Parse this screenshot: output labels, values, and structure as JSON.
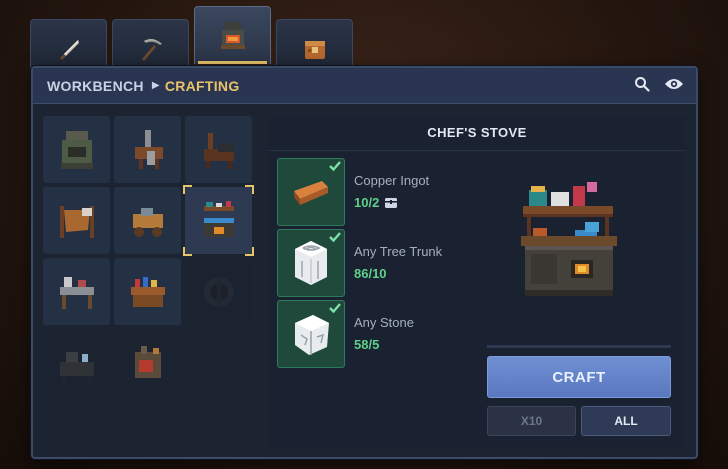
{
  "tabs": [
    {
      "icon": "knife-icon",
      "active": false
    },
    {
      "icon": "pickaxe-icon",
      "active": false
    },
    {
      "icon": "workbench-icon",
      "active": true
    },
    {
      "icon": "crate-icon",
      "active": false
    }
  ],
  "header": {
    "crumb_root": "WORKBENCH",
    "crumb_active": "CRAFTING",
    "search_icon": "search-icon",
    "eye_icon": "eye-icon"
  },
  "recipes": [
    {
      "icon": "furnace-icon"
    },
    {
      "icon": "tool-station-icon"
    },
    {
      "icon": "anvil-icon"
    },
    {
      "icon": "leather-rack-icon"
    },
    {
      "icon": "wood-cart-icon"
    },
    {
      "icon": "chefs-stove-icon",
      "selected": true
    },
    {
      "icon": "sewing-table-icon"
    },
    {
      "icon": "alchemy-table-icon"
    },
    {
      "icon": "locked-wheel-icon",
      "dim": true
    },
    {
      "icon": "grill-station-icon"
    },
    {
      "icon": "smelter-icon"
    }
  ],
  "detail": {
    "title": "CHEF'S STOVE",
    "ingredients": [
      {
        "name": "Copper Ingot",
        "count": "10/2",
        "icon": "copper-ingot-icon",
        "extra_icon": "chest-icon"
      },
      {
        "name": "Any Tree Trunk",
        "count": "86/10",
        "icon": "tree-trunk-icon"
      },
      {
        "name": "Any Stone",
        "count": "58/5",
        "icon": "stone-icon"
      }
    ],
    "preview_icon": "chefs-stove-preview",
    "craft_label": "CRAFT",
    "x10_label": "X10",
    "all_label": "ALL"
  },
  "colors": {
    "accent": "#e9c36a",
    "count_green": "#5fd08a",
    "craft_blue": "#6f8fd3"
  }
}
